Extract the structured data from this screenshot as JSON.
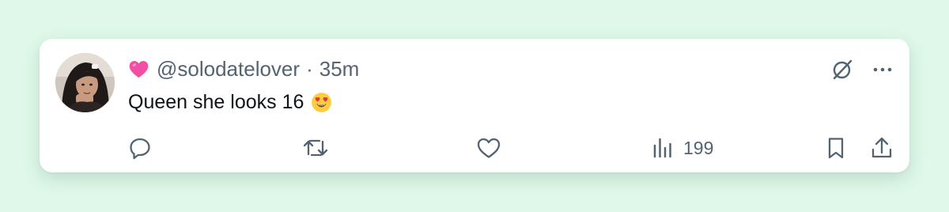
{
  "tweet": {
    "author_emoji": "pink-heart-emoji",
    "handle": "@solodatelover",
    "separator": "·",
    "time_ago": "35m",
    "text": "Queen she looks 16",
    "text_emoji": "heart-eyes-emoji"
  },
  "actions": {
    "reply": {
      "icon": "reply-icon",
      "count": ""
    },
    "repost": {
      "icon": "repost-icon",
      "count": ""
    },
    "like": {
      "icon": "heart-icon",
      "count": ""
    },
    "views": {
      "icon": "views-icon",
      "count": "199"
    },
    "bookmark": {
      "icon": "bookmark-icon"
    },
    "share": {
      "icon": "share-icon"
    }
  },
  "top_icons": [
    "grok-icon",
    "more-icon"
  ],
  "colors": {
    "background": "#dff8e9",
    "card": "#ffffff",
    "text_primary": "#0f1419",
    "text_secondary": "#536471",
    "heart_emoji": "#f14fa4"
  }
}
